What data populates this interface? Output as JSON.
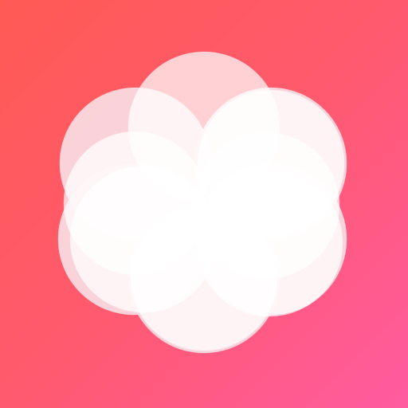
{
  "icon": {
    "name": "flower-logo-icon",
    "petal_count": 6,
    "colors": {
      "gradient_start": "#ff5a54",
      "gradient_end": "#ff5ba0",
      "petal_light": "#ffffff",
      "petal_tint": "#f8dde3"
    }
  }
}
